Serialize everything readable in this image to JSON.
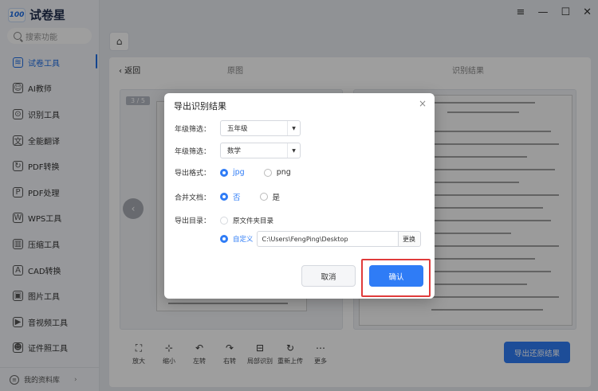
{
  "app": {
    "logo_badge": "100",
    "name": "试卷星",
    "search_placeholder": "搜索功能",
    "window_controls": [
      "≡",
      "—",
      "☐",
      "✕"
    ]
  },
  "sidebar": {
    "items": [
      {
        "label": "试卷工具",
        "icon": "layers-icon",
        "glyph": "≋",
        "active": true
      },
      {
        "label": "AI教师",
        "icon": "teacher-icon",
        "glyph": "☺",
        "active": false
      },
      {
        "label": "识别工具",
        "icon": "scan-icon",
        "glyph": "⊙",
        "active": false
      },
      {
        "label": "全能翻译",
        "icon": "translate-icon",
        "glyph": "文",
        "active": false
      },
      {
        "label": "PDF转换",
        "icon": "pdf-convert-icon",
        "glyph": "↻",
        "active": false
      },
      {
        "label": "PDF处理",
        "icon": "pdf-process-icon",
        "glyph": "P",
        "active": false
      },
      {
        "label": "WPS工具",
        "icon": "wps-icon",
        "glyph": "W",
        "active": false
      },
      {
        "label": "压缩工具",
        "icon": "compress-icon",
        "glyph": "▥",
        "active": false
      },
      {
        "label": "CAD转换",
        "icon": "cad-icon",
        "glyph": "A",
        "active": false
      },
      {
        "label": "图片工具",
        "icon": "image-icon",
        "glyph": "▣",
        "active": false
      },
      {
        "label": "音视频工具",
        "icon": "media-icon",
        "glyph": "▶",
        "active": false
      },
      {
        "label": "证件照工具",
        "icon": "id-photo-icon",
        "glyph": "☻",
        "active": false
      }
    ],
    "library": "我的资料库",
    "library_arrow": "›"
  },
  "main": {
    "back": "‹  返回",
    "left_title": "原图",
    "right_title": "识别结果",
    "page_indicator": "3 / 5",
    "prev_glyph": "‹",
    "tools": [
      {
        "label": "放大",
        "icon": "zoom-in-icon",
        "glyph": "⛶"
      },
      {
        "label": "缩小",
        "icon": "zoom-out-icon",
        "glyph": "⊹"
      },
      {
        "label": "左转",
        "icon": "rotate-left-icon",
        "glyph": "↶"
      },
      {
        "label": "右转",
        "icon": "rotate-right-icon",
        "glyph": "↷"
      },
      {
        "label": "局部识别",
        "icon": "partial-recognize-icon",
        "glyph": "⊟"
      },
      {
        "label": "重新上传",
        "icon": "reupload-icon",
        "glyph": "↻"
      },
      {
        "label": "更多",
        "icon": "more-icon",
        "glyph": "⋯"
      }
    ],
    "export_button": "导出还原结果"
  },
  "dialog": {
    "title": "导出识别结果",
    "close": "×",
    "grade_label": "年级筛选：",
    "grade_value": "五年级",
    "subject_label": "年级筛选：",
    "subject_value": "数学",
    "dropdown_arrow": "▼",
    "format_label": "导出格式：",
    "format_options": [
      "jpg",
      "png"
    ],
    "format_selected": "jpg",
    "merge_label": "合并文档：",
    "merge_options": [
      "否",
      "是"
    ],
    "merge_selected": "否",
    "dir_label": "导出目录：",
    "dir_option_original": "原文件夹目录",
    "dir_option_custom": "自定义",
    "dir_path": "C:\\Users\\FengPing\\Desktop",
    "dir_change": "更换",
    "cancel": "取消",
    "confirm": "确认"
  },
  "colors": {
    "accent": "#2f7cf6",
    "highlight": "#e03b3b"
  }
}
